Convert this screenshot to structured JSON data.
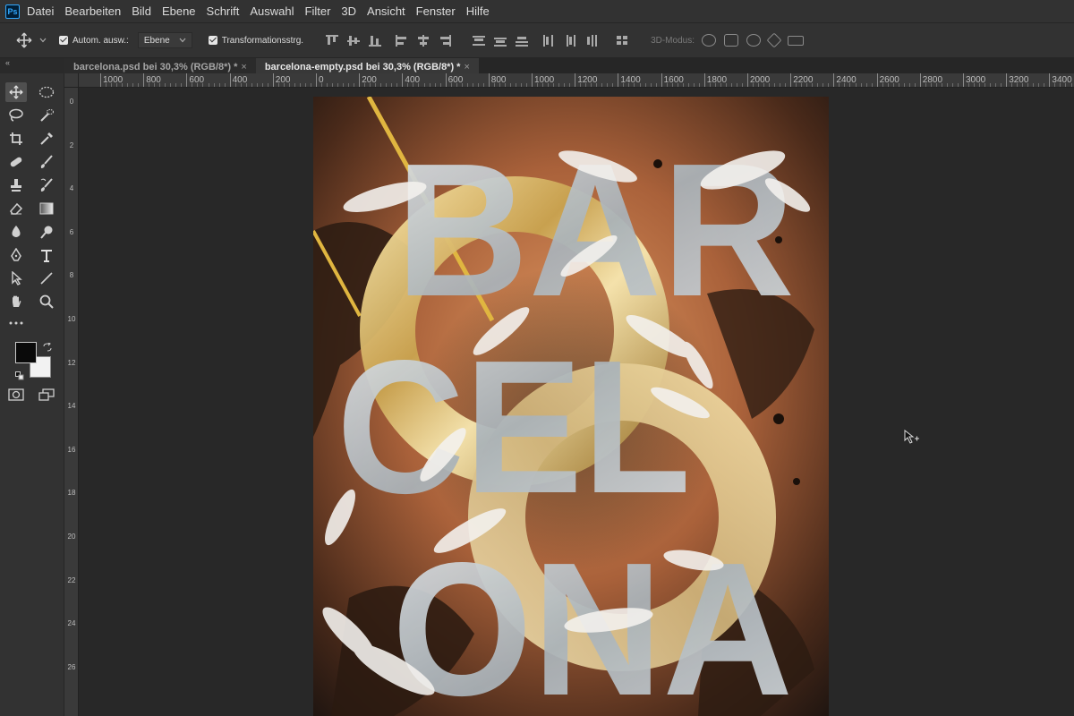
{
  "app": {
    "logo_text": "Ps"
  },
  "menu": [
    "Datei",
    "Bearbeiten",
    "Bild",
    "Ebene",
    "Schrift",
    "Auswahl",
    "Filter",
    "3D",
    "Ansicht",
    "Fenster",
    "Hilfe"
  ],
  "options": {
    "auto_select_label": "Autom. ausw.:",
    "auto_select_checked": true,
    "auto_select_target": "Ebene",
    "transform_label": "Transformationsstrg.",
    "transform_checked": true,
    "mode_3d_label": "3D-Modus:"
  },
  "panel_collapse": "«",
  "tabs": [
    {
      "title": "barcelona.psd bei 30,3% (RGB/8*) *",
      "close": "×",
      "active": false
    },
    {
      "title": "barcelona-empty.psd bei 30,3% (RGB/8*) *",
      "close": "×",
      "active": true
    }
  ],
  "ruler_h_labels": [
    "1000",
    "800",
    "600",
    "400",
    "200",
    "0",
    "200",
    "400",
    "600",
    "800",
    "1000",
    "1200",
    "1400",
    "1600",
    "1800",
    "2000",
    "2200",
    "2400",
    "2600",
    "2800",
    "3000",
    "3200",
    "3400"
  ],
  "ruler_v_labels": [
    "0",
    "2",
    "4",
    "6",
    "8",
    "10",
    "12",
    "14",
    "16",
    "18",
    "20",
    "22",
    "24",
    "26"
  ],
  "poster": {
    "word_top": "BAR",
    "word_middle": "CEL",
    "word_bottom": "ONA"
  },
  "colors": {
    "foreground": "#0a0a0a",
    "background": "#f2f2f2",
    "ui_dark": "#282828",
    "ui_panel": "#323232",
    "accent_gold": "#e0b640"
  },
  "tools": [
    "move-tool",
    "marquee-tool",
    "lasso-tool",
    "quick-select-tool",
    "crop-tool",
    "eyedropper-tool",
    "healing-tool",
    "brush-tool",
    "stamp-tool",
    "history-brush-tool",
    "eraser-tool",
    "gradient-tool",
    "blur-tool",
    "dodge-tool",
    "pen-tool",
    "type-tool",
    "path-select-tool",
    "line-tool",
    "hand-tool",
    "zoom-tool",
    "more-tools",
    "quick-mask",
    "screen-mode"
  ]
}
